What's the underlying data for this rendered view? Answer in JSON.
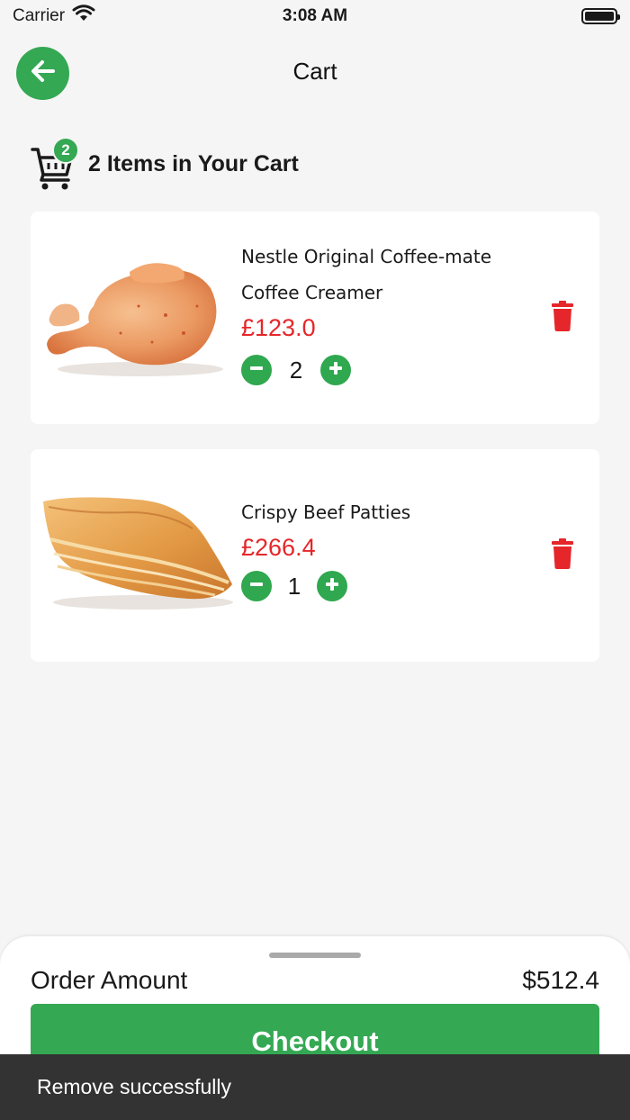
{
  "status_bar": {
    "carrier": "Carrier",
    "time": "3:08 AM"
  },
  "header": {
    "title": "Cart",
    "back_icon": "arrow-left-icon"
  },
  "cart_summary": {
    "count_badge": "2",
    "text": "2 Items in Your Cart"
  },
  "items": [
    {
      "name_line1": "Nestle Original Coffee-mate",
      "name_line2": "Coffee Creamer",
      "price": "£123.0",
      "quantity": "2",
      "image": "roast-chicken"
    },
    {
      "name_line1": "Crispy Beef Patties",
      "price": "£266.4",
      "quantity": "1",
      "image": "beef-patty-pastry"
    }
  ],
  "order": {
    "label": "Order Amount",
    "amount": "$512.4"
  },
  "checkout": {
    "label": "Checkout"
  },
  "toast": {
    "message": "Remove successfully"
  },
  "colors": {
    "accent": "#34a853",
    "price": "#e5262a",
    "toast_bg": "#333333"
  }
}
